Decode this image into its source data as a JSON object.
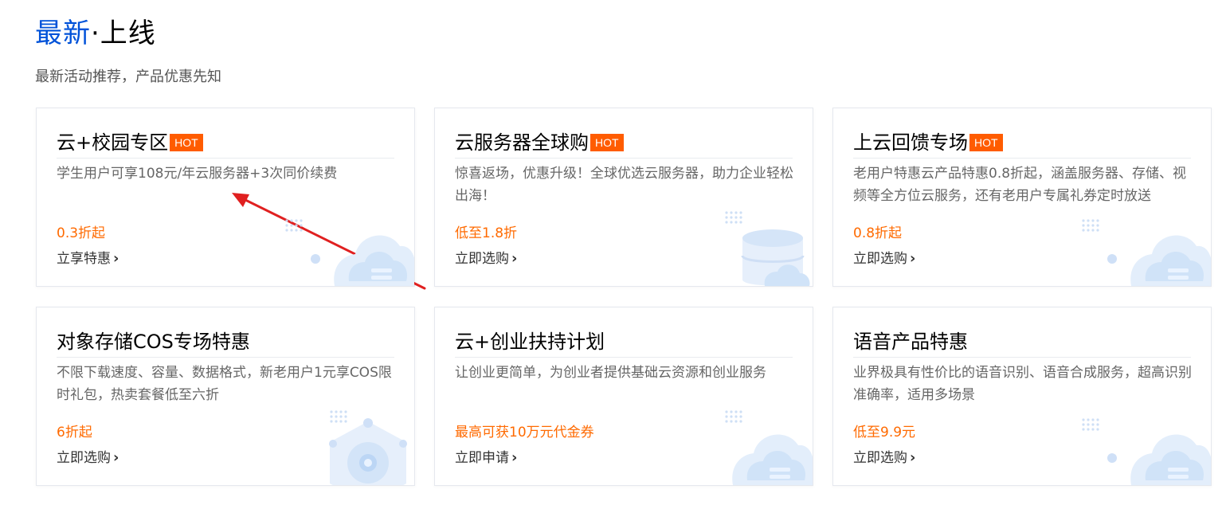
{
  "section": {
    "title_accent": "最新",
    "title_rest": "·上线",
    "subtitle": "最新活动推荐，产品优惠先知"
  },
  "cards": [
    {
      "title": "云+校园专区",
      "hot": "HOT",
      "desc": "学生用户可享108元/年云服务器+3次同价续费",
      "price": "0.3折起",
      "link": "立享特惠",
      "illustration": "cloud-icon"
    },
    {
      "title": "云服务器全球购",
      "hot": "HOT",
      "desc": "惊喜返场，优惠升级！全球优选云服务器，助力企业轻松出海！",
      "price": "低至1.8折",
      "link": "立即选购",
      "illustration": "database-cloud-icon"
    },
    {
      "title": "上云回馈专场",
      "hot": "HOT",
      "desc": "老用户特惠云产品特惠0.8折起，涵盖服务器、存储、视频等全方位云服务，还有老用户专属礼券定时放送",
      "price": "0.8折起",
      "link": "立即选购",
      "illustration": "cloud-icon"
    },
    {
      "title": "对象存储COS专场特惠",
      "hot": "",
      "desc": "不限下载速度、容量、数据格式，新老用户1元享COS限时礼包，热卖套餐低至六折",
      "price": "6折起",
      "link": "立即选购",
      "illustration": "hexagon-node-icon"
    },
    {
      "title": "云+创业扶持计划",
      "hot": "",
      "desc": "让创业更简单，为创业者提供基础云资源和创业服务",
      "price": "最高可获10万元代金券",
      "link": "立即申请",
      "illustration": "cloud-icon"
    },
    {
      "title": "语音产品特惠",
      "hot": "",
      "desc": "业界极具有性价比的语音识别、语音合成服务，超高识别准确率，适用多场景",
      "price": "低至9.9元",
      "link": "立即选购",
      "illustration": "cloud-icon"
    }
  ],
  "annotation": {
    "arrow_color": "#e02020"
  },
  "colors": {
    "accent": "#0052d9",
    "hot_badge": "#ff5c00",
    "price": "#ff6a00"
  }
}
